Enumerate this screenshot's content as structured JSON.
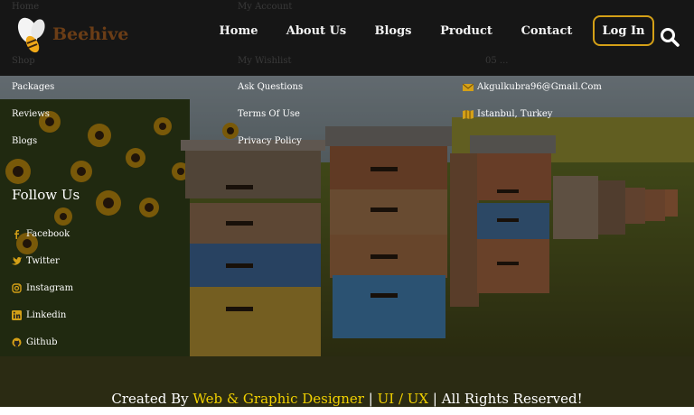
{
  "brand": {
    "name": "Beehive",
    "accent": "#d4a017"
  },
  "nav": {
    "items": [
      {
        "label": "Home"
      },
      {
        "label": "About Us"
      },
      {
        "label": "Blogs"
      },
      {
        "label": "Product"
      },
      {
        "label": "Contact"
      }
    ],
    "login_label": "Log In"
  },
  "behind_nav": {
    "col1": [
      "Home",
      "Shop"
    ],
    "col2": [
      "My Account",
      "My Wishlist"
    ],
    "col3": [
      "05 ..."
    ]
  },
  "links_col1": [
    "Packages",
    "Reviews",
    "Blogs"
  ],
  "links_col2": [
    "Ask Questions",
    "Terms Of Use",
    "Privacy Policy"
  ],
  "contact": {
    "email": "Akgulkubra96@Gmail.Com",
    "location": "Istanbul, Turkey"
  },
  "follow": {
    "title": "Follow Us",
    "items": [
      {
        "label": "Facebook",
        "icon": "facebook-icon"
      },
      {
        "label": "Twitter",
        "icon": "twitter-icon"
      },
      {
        "label": "Instagram",
        "icon": "instagram-icon"
      },
      {
        "label": "Linkedin",
        "icon": "linkedin-icon"
      },
      {
        "label": "Github",
        "icon": "github-icon"
      }
    ]
  },
  "credit": {
    "prefix": "Created By",
    "role1": "Web & Graphic Designer",
    "sep": "|",
    "role2": "UI / UX",
    "suffix": "| All Rights Reserved!"
  }
}
